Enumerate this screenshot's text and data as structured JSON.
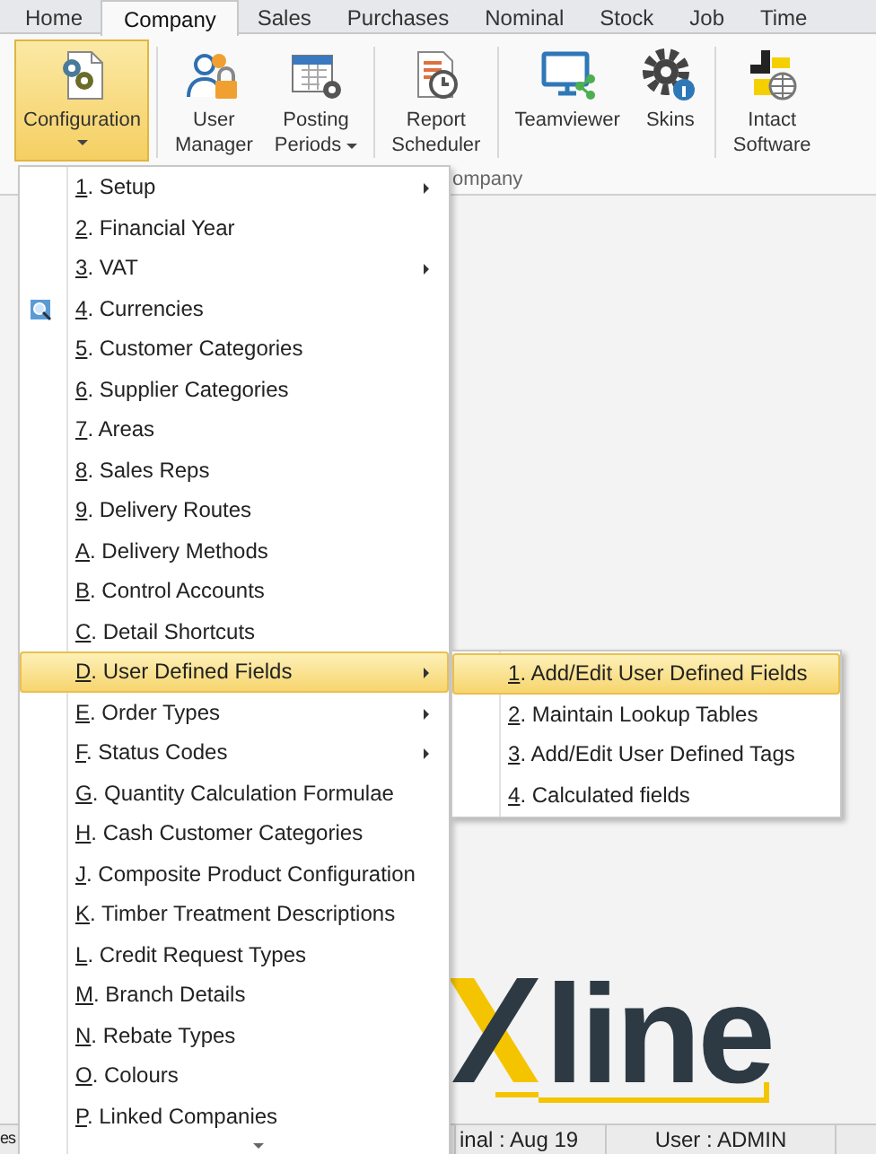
{
  "tabs": [
    {
      "label": "Home",
      "selected": false
    },
    {
      "label": "Company",
      "selected": true
    },
    {
      "label": "Sales",
      "selected": false
    },
    {
      "label": "Purchases",
      "selected": false
    },
    {
      "label": "Nominal",
      "selected": false
    },
    {
      "label": "Stock",
      "selected": false
    },
    {
      "label": "Job",
      "selected": false
    },
    {
      "label": "Time",
      "selected": false
    }
  ],
  "ribbon": {
    "buttons": [
      {
        "kind": "config",
        "lines": [
          "Configuration"
        ],
        "dropdown": true,
        "selected": true
      },
      {
        "kind": "users",
        "lines": [
          "User",
          "Manager"
        ],
        "dropdown": false,
        "selected": false
      },
      {
        "kind": "calendar",
        "lines": [
          "Posting",
          "Periods"
        ],
        "dropdown": true,
        "selected": false
      },
      {
        "kind": "report",
        "lines": [
          "Report",
          "Scheduler"
        ],
        "dropdown": false,
        "selected": false
      },
      {
        "kind": "monitor",
        "lines": [
          "Teamviewer"
        ],
        "dropdown": false,
        "selected": false
      },
      {
        "kind": "gear",
        "lines": [
          "Skins"
        ],
        "dropdown": false,
        "selected": false
      },
      {
        "kind": "globe",
        "lines": [
          "Intact",
          "Software"
        ],
        "dropdown": false,
        "selected": false
      }
    ],
    "group_label": "ompany"
  },
  "menu": {
    "items": [
      {
        "key": "1",
        "label": ". Setup",
        "submenu": true,
        "icon": false,
        "highlighted": false
      },
      {
        "key": "2",
        "label": ". Financial Year",
        "submenu": false,
        "icon": false,
        "highlighted": false
      },
      {
        "key": "3",
        "label": ". VAT",
        "submenu": true,
        "icon": false,
        "highlighted": false
      },
      {
        "key": "4",
        "label": ". Currencies",
        "submenu": false,
        "icon": true,
        "highlighted": false
      },
      {
        "key": "5",
        "label": ". Customer Categories",
        "submenu": false,
        "icon": false,
        "highlighted": false
      },
      {
        "key": "6",
        "label": ". Supplier Categories",
        "submenu": false,
        "icon": false,
        "highlighted": false
      },
      {
        "key": "7",
        "label": ". Areas",
        "submenu": false,
        "icon": false,
        "highlighted": false
      },
      {
        "key": "8",
        "label": ". Sales Reps",
        "submenu": false,
        "icon": false,
        "highlighted": false
      },
      {
        "key": "9",
        "label": ". Delivery Routes",
        "submenu": false,
        "icon": false,
        "highlighted": false
      },
      {
        "key": "A",
        "label": ". Delivery Methods",
        "submenu": false,
        "icon": false,
        "highlighted": false
      },
      {
        "key": "B",
        "label": ". Control Accounts",
        "submenu": false,
        "icon": false,
        "highlighted": false
      },
      {
        "key": "C",
        "label": ". Detail Shortcuts",
        "submenu": false,
        "icon": false,
        "highlighted": false
      },
      {
        "key": "D",
        "label": ". User Defined Fields",
        "submenu": true,
        "icon": false,
        "highlighted": true
      },
      {
        "key": "E",
        "label": ". Order Types",
        "submenu": true,
        "icon": false,
        "highlighted": false
      },
      {
        "key": "F",
        "label": ". Status Codes",
        "submenu": true,
        "icon": false,
        "highlighted": false
      },
      {
        "key": "G",
        "label": ". Quantity Calculation Formulae",
        "submenu": false,
        "icon": false,
        "highlighted": false
      },
      {
        "key": "H",
        "label": ". Cash Customer Categories",
        "submenu": false,
        "icon": false,
        "highlighted": false
      },
      {
        "key": "J",
        "label": ". Composite Product Configuration",
        "submenu": false,
        "icon": false,
        "highlighted": false
      },
      {
        "key": "K",
        "label": ". Timber Treatment Descriptions",
        "submenu": false,
        "icon": false,
        "highlighted": false
      },
      {
        "key": "L",
        "label": ". Credit Request Types",
        "submenu": false,
        "icon": false,
        "highlighted": false
      },
      {
        "key": "M",
        "label": ". Branch Details",
        "submenu": false,
        "icon": false,
        "highlighted": false
      },
      {
        "key": "N",
        "label": ". Rebate Types",
        "submenu": false,
        "icon": false,
        "highlighted": false
      },
      {
        "key": "O",
        "label": ". Colours",
        "submenu": false,
        "icon": false,
        "highlighted": false
      },
      {
        "key": "P",
        "label": ". Linked Companies",
        "submenu": false,
        "icon": false,
        "highlighted": false
      }
    ],
    "more_below": true
  },
  "submenu": {
    "items": [
      {
        "key": "1",
        "label": ". Add/Edit User Defined Fields",
        "selected": true
      },
      {
        "key": "2",
        "label": ". Maintain Lookup Tables",
        "selected": false
      },
      {
        "key": "3",
        "label": ". Add/Edit User Defined Tags",
        "selected": false
      },
      {
        "key": "4",
        "label": ". Calculated fields",
        "selected": false
      }
    ]
  },
  "logo": {
    "text": "line"
  },
  "status_bar": [
    "es",
    "inal : Aug 19",
    "User : ADMIN"
  ]
}
